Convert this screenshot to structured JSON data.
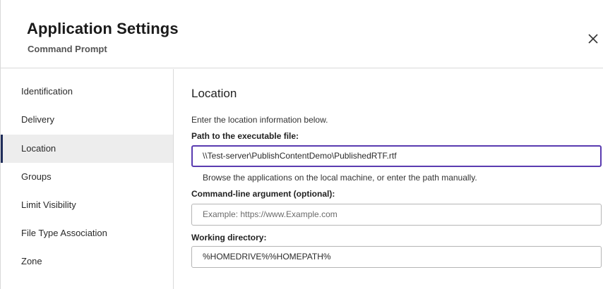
{
  "header": {
    "title": "Application Settings",
    "subtitle": "Command Prompt",
    "close_icon": "close-icon"
  },
  "sidebar": {
    "items": [
      {
        "label": "Identification",
        "active": false
      },
      {
        "label": "Delivery",
        "active": false
      },
      {
        "label": "Location",
        "active": true
      },
      {
        "label": "Groups",
        "active": false
      },
      {
        "label": "Limit Visibility",
        "active": false
      },
      {
        "label": "File Type Association",
        "active": false
      },
      {
        "label": "Zone",
        "active": false
      }
    ]
  },
  "location": {
    "section_title": "Location",
    "instructions": "Enter the location information below.",
    "path_label": "Path to the executable file:",
    "path_value": "\\\\Test-server\\PublishContentDemo\\PublishedRTF.rtf",
    "path_help": "Browse the applications on the local machine, or enter the path manually.",
    "cmd_label": "Command-line argument (optional):",
    "cmd_value": "",
    "cmd_placeholder": "Example: https://www.Example.com",
    "workdir_label": "Working directory:",
    "workdir_value": "%HOMEDRIVE%%HOMEPATH%"
  },
  "colors": {
    "focus_border": "#5a3bb0",
    "active_bar": "#1f2d5a",
    "active_bg": "#ededed"
  }
}
